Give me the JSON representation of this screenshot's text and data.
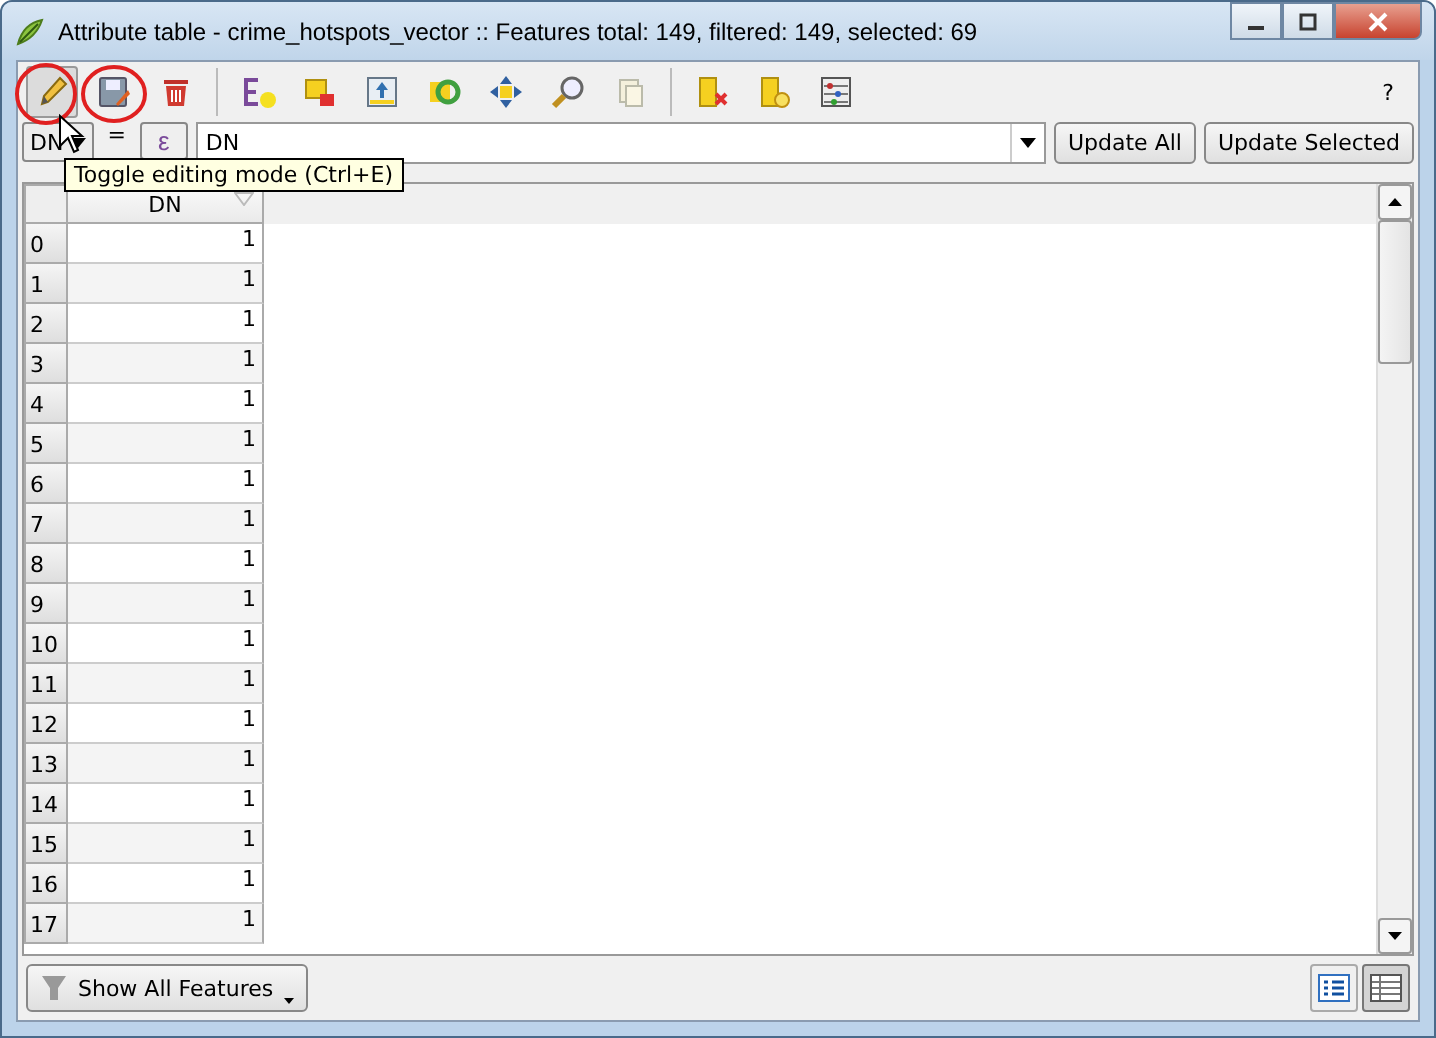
{
  "window": {
    "title": "Attribute table - crime_hotspots_vector :: Features total: 149, filtered: 149, selected: 69"
  },
  "toolbar": {
    "help": "?"
  },
  "tooltip": "Toggle editing mode (Ctrl+E)",
  "expression_bar": {
    "field": "DN",
    "operator": "=",
    "expression_button": "ε",
    "value": "DN",
    "buttons": [
      "Update All",
      "Update Selected"
    ]
  },
  "table": {
    "columns": [
      "DN"
    ],
    "rows": [
      {
        "index": "0",
        "dn": "1"
      },
      {
        "index": "1",
        "dn": "1"
      },
      {
        "index": "2",
        "dn": "1"
      },
      {
        "index": "3",
        "dn": "1"
      },
      {
        "index": "4",
        "dn": "1"
      },
      {
        "index": "5",
        "dn": "1"
      },
      {
        "index": "6",
        "dn": "1"
      },
      {
        "index": "7",
        "dn": "1"
      },
      {
        "index": "8",
        "dn": "1"
      },
      {
        "index": "9",
        "dn": "1"
      },
      {
        "index": "10",
        "dn": "1"
      },
      {
        "index": "11",
        "dn": "1"
      },
      {
        "index": "12",
        "dn": "1"
      },
      {
        "index": "13",
        "dn": "1"
      },
      {
        "index": "14",
        "dn": "1"
      },
      {
        "index": "15",
        "dn": "1"
      },
      {
        "index": "16",
        "dn": "1"
      },
      {
        "index": "17",
        "dn": "1"
      }
    ]
  },
  "bottom_bar": {
    "filter_button": "Show All Features",
    "views": [
      {
        "kind": "form",
        "selected": false
      },
      {
        "kind": "table",
        "selected": true
      }
    ]
  }
}
